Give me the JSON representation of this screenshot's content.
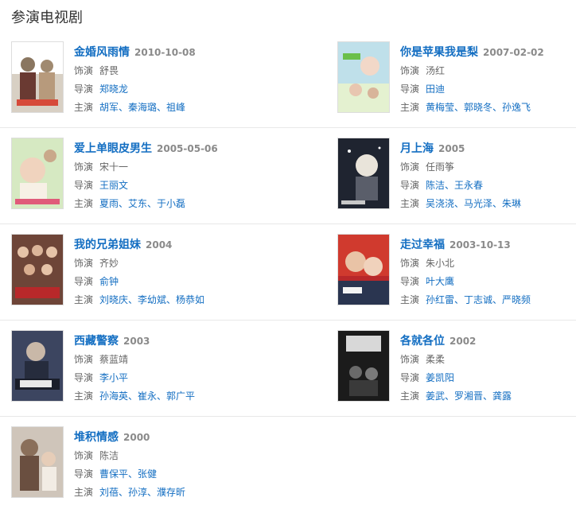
{
  "section_title": "参演电视剧",
  "labels": {
    "role": "饰演",
    "director": "导演",
    "cast": "主演"
  },
  "colors": {
    "link": "#136ec2",
    "muted": "#666666",
    "date": "#8a8a8a",
    "divider": "#e8e8e8"
  },
  "dramas": [
    {
      "title": "金婚风雨情",
      "date": "2010-10-08",
      "role": "舒畏",
      "director": "郑晓龙",
      "cast": "胡军、秦海璐、祖峰",
      "poster_color": "#c9b9a0"
    },
    {
      "title": "你是苹果我是梨",
      "date": "2007-02-02",
      "role": "汤红",
      "director": "田迪",
      "cast": "黄梅莹、郭晓冬、孙逸飞",
      "poster_color": "#9ec7d6"
    },
    {
      "title": "爱上单眼皮男生",
      "date": "2005-05-06",
      "role": "宋十一",
      "director": "王丽文",
      "cast": "夏雨、艾东、于小磊",
      "poster_color": "#cfe3b4"
    },
    {
      "title": "月上海",
      "date": "2005",
      "role": "任雨筝",
      "director": "陈洁、王永春",
      "cast": "吴浇浇、马光泽、朱琳",
      "poster_color": "#2a2f3d"
    },
    {
      "title": "我的兄弟姐妹",
      "date": "2004",
      "role": "齐妙",
      "director": "俞钟",
      "cast": "刘晓庆、李幼斌、杨恭如",
      "poster_color": "#7d4a3a"
    },
    {
      "title": "走过幸福",
      "date": "2003-10-13",
      "role": "朱小北",
      "director": "叶大鹰",
      "cast": "孙红雷、丁志诚、严晓频",
      "poster_color": "#c7302a"
    },
    {
      "title": "西藏警察",
      "date": "2003",
      "role": "蔡蓝靖",
      "director": "李小平",
      "cast": "孙海英、崔永、郭广平",
      "poster_color": "#3e4760"
    },
    {
      "title": "各就各位",
      "date": "2002",
      "role": "柔柔",
      "director": "姜凯阳",
      "cast": "姜武、罗湘晋、龚露",
      "poster_color": "#1e1e1e"
    },
    {
      "title": "堆积情感",
      "date": "2000",
      "role": "陈洁",
      "director": "曹保平、张健",
      "cast": "刘蓓、孙淳、濮存昕",
      "poster_color": "#bcb1a6"
    }
  ]
}
